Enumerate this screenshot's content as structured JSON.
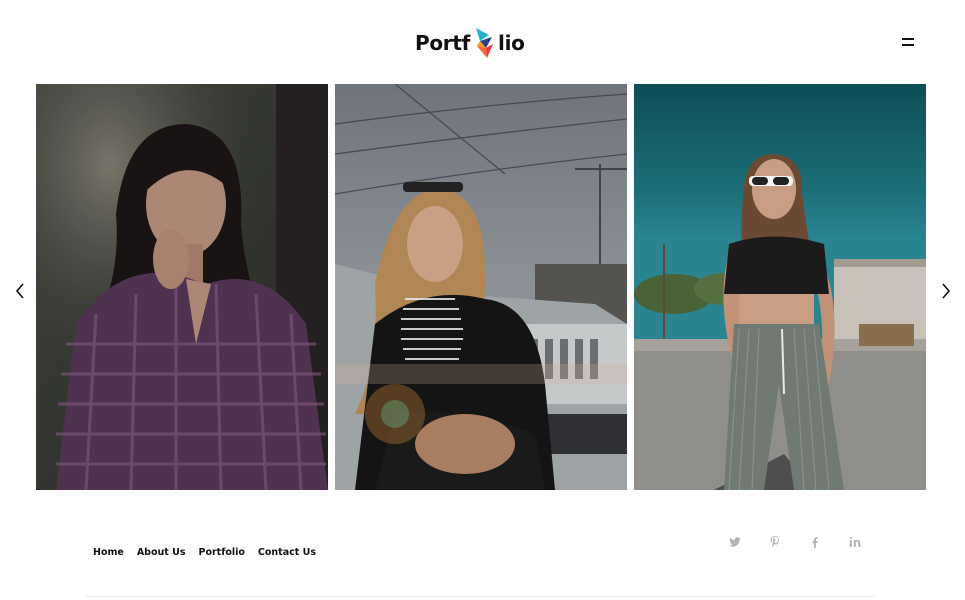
{
  "header": {
    "logo_left": "Portf",
    "logo_right": "lio"
  },
  "slider": {
    "slides": [
      {
        "icon": "photo-woman-plaid-shirt"
      },
      {
        "icon": "photo-woman-car"
      },
      {
        "icon": "photo-woman-street"
      }
    ]
  },
  "footer": {
    "nav": [
      {
        "label": "Home"
      },
      {
        "label": "About Us"
      },
      {
        "label": "Portfolio"
      },
      {
        "label": "Contact Us"
      }
    ],
    "social": [
      "twitter-icon",
      "pinterest-icon",
      "facebook-icon",
      "linkedin-icon"
    ]
  },
  "colors": {
    "text": "#111111",
    "social": "#b4b4b4",
    "logo_red": "#e8343c",
    "logo_teal": "#1fb6c9",
    "logo_orange": "#f39a2a"
  }
}
